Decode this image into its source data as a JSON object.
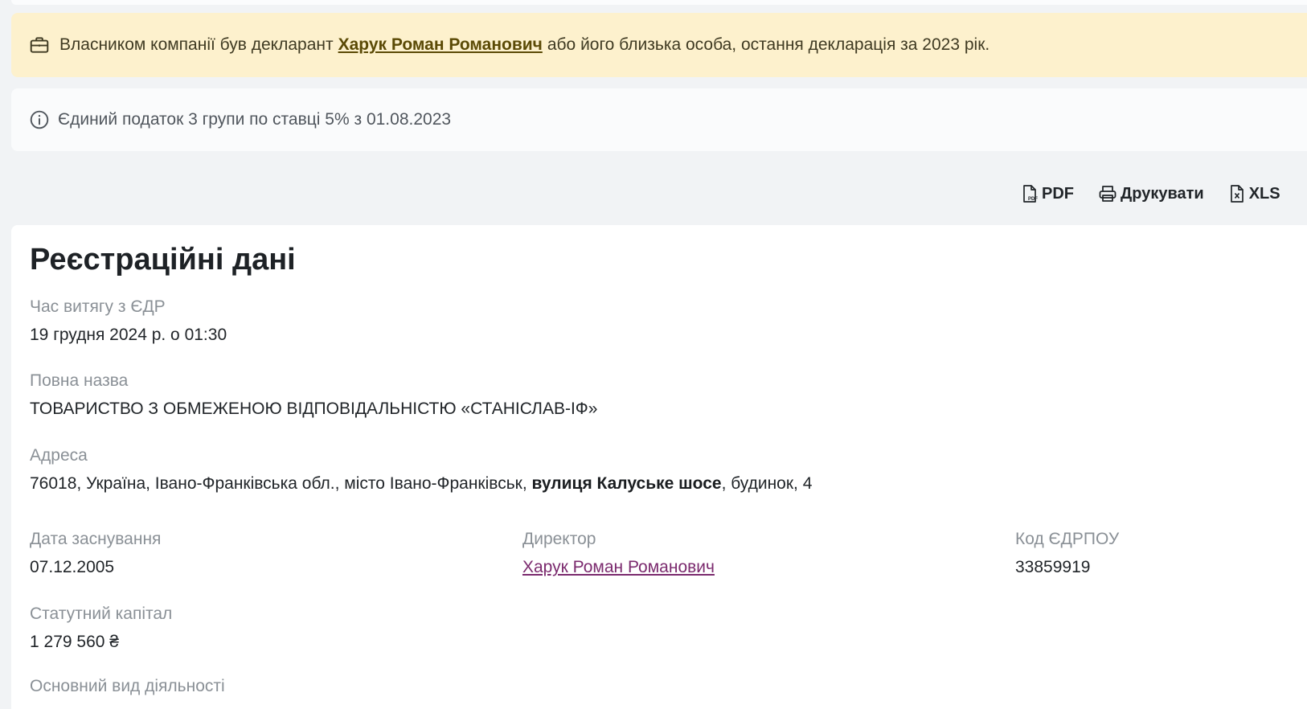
{
  "colors": {
    "alert_background": "#fdf1cd",
    "alert_link": "#5b4a06",
    "director_link": "#7b2a6e",
    "label_gray": "#8a9096"
  },
  "owner_alert": {
    "icon": "briefcase-icon",
    "text_before": "Власником компанії був декларант",
    "owner_name": "Харук Роман Романович",
    "text_after": "або його близька особа, остання декларація за 2023 рік."
  },
  "tax_info": {
    "icon": "info-circle-icon",
    "text": "Єдиний податок 3 групи по ставці 5% з 01.08.2023"
  },
  "toolbar": {
    "pdf_icon": "pdf-file-icon",
    "pdf_label": "PDF",
    "print_icon": "printer-icon",
    "print_label": "Друкувати",
    "xls_icon": "excel-file-icon",
    "xls_label": "XLS"
  },
  "registration": {
    "title": "Реєстраційні дані",
    "extract_time": {
      "label": "Час витягу з ЄДР",
      "value": "19 грудня 2024 р. о 01:30"
    },
    "full_name": {
      "label": "Повна назва",
      "value": "ТОВАРИСТВО З ОБМЕЖЕНОЮ ВІДПОВІДАЛЬНІСТЮ «СТАНІСЛАВ-ІФ»"
    },
    "address": {
      "label": "Адреса",
      "value_before": "76018, Україна, Івано-Франківська обл., місто Івано-Франківськ,",
      "street": "вулиця Калуське шосе",
      "value_after": ", будинок, 4"
    },
    "founded": {
      "label": "Дата заснування",
      "value": "07.12.2005"
    },
    "director": {
      "label": "Директор",
      "value": "Харук Роман Романович"
    },
    "edrpou": {
      "label": "Код ЄДРПОУ",
      "value": "33859919"
    },
    "capital": {
      "label": "Статутний капітал",
      "value": "1 279 560 ₴"
    },
    "next_field_label": "Основний вид діяльності"
  }
}
